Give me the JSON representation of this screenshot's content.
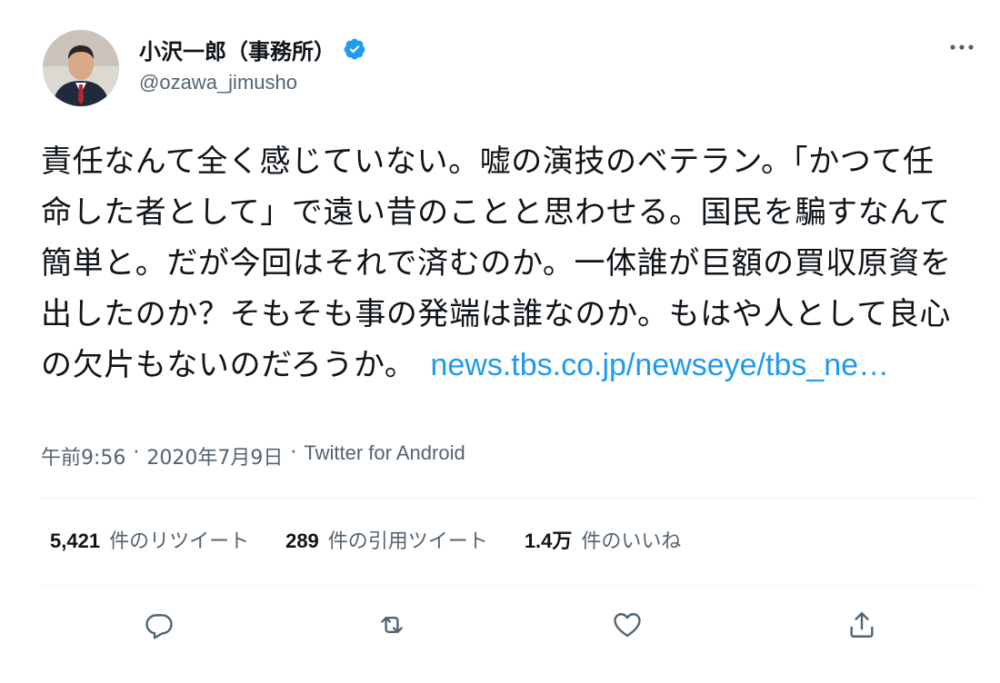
{
  "author": {
    "display_name": "小沢一郎（事務所）",
    "handle": "@ozawa_jimusho",
    "verified": true,
    "avatar_icon": "avatar-photo"
  },
  "tweet": {
    "text": "責任なんて全く感じていない。嘘の演技のベテラン。「かつて任命した者として」で遠い昔のことと思わせる。国民を騙すなんて簡単と。だが今回はそれで済むのか。一体誰が巨額の買収原資を出したのか？そもそも事の発端は誰なのか。もはや人として良心の欠片もないのだろうか。",
    "link_text": "news.tbs.co.jp/newseye/tbs_ne…",
    "link_color": "#1d9bf0"
  },
  "meta": {
    "time": "午前9:56",
    "sep1": "·",
    "date": "2020年7月9日",
    "sep2": "·",
    "source": "Twitter for Android"
  },
  "stats": {
    "retweets": {
      "count": "5,421",
      "label": "件のリツイート"
    },
    "quotes": {
      "count": "289",
      "label": "件の引用ツイート"
    },
    "likes": {
      "count": "1.4万",
      "label": "件のいいね"
    }
  },
  "actions": {
    "reply": "reply-icon",
    "retweet": "retweet-icon",
    "like": "heart-icon",
    "share": "share-icon"
  },
  "colors": {
    "text": "#0f1419",
    "secondary": "#536471",
    "accent": "#1d9bf0",
    "divider": "#eff3f4"
  }
}
